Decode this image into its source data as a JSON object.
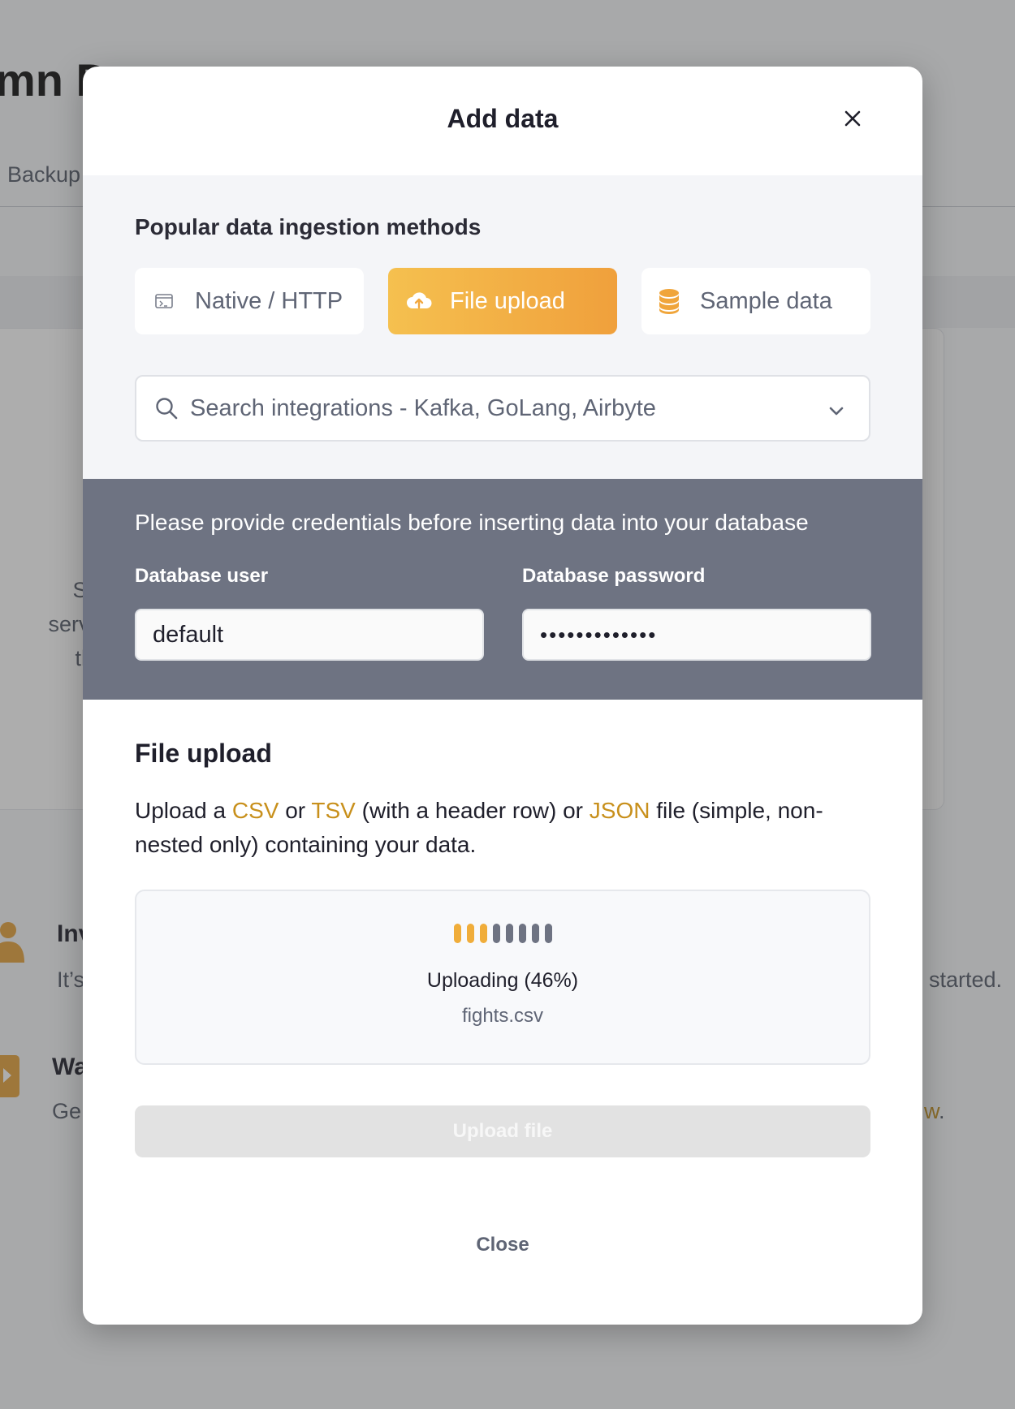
{
  "background": {
    "title_fragment": "mn D",
    "tab_fragment": "Backup",
    "card_text": [
      "Sta",
      "servic",
      "the"
    ],
    "item1": {
      "title_fragment": "Inv",
      "desc_fragment": "It’s",
      "right_fragment": "started."
    },
    "item2": {
      "title_fragment": "Wa",
      "desc_fragment": "Ge",
      "right_fragment": "w",
      "right_suffix": "."
    }
  },
  "modal": {
    "title": "Add data",
    "close_icon": "close-icon",
    "methods": {
      "label": "Popular data ingestion methods",
      "items": [
        {
          "label": "Native / HTTP",
          "icon": "terminal-icon",
          "selected": false
        },
        {
          "label": "File upload",
          "icon": "cloud-upload-icon",
          "selected": true
        },
        {
          "label": "Sample data",
          "icon": "database-icon",
          "selected": false
        }
      ]
    },
    "search": {
      "placeholder": "Search integrations - Kafka, GoLang, Airbyte"
    },
    "credentials": {
      "message": "Please provide credentials before inserting data into your database",
      "user_label": "Database user",
      "user_value": "default",
      "password_label": "Database password",
      "password_value": "•••••••••••••"
    },
    "file_upload": {
      "heading": "File upload",
      "desc_1": "Upload a ",
      "kw_csv": "CSV",
      "desc_2": " or ",
      "kw_tsv": "TSV",
      "desc_3": " (with a header row) or ",
      "kw_json": "JSON",
      "desc_4": " file (simple, non-nested only) containing your data.",
      "progress_percent": 46,
      "status": "Uploading (46%)",
      "filename": "fights.csv",
      "upload_button": "Upload file",
      "close_label": "Close"
    },
    "colors": {
      "accent": "#f0ad3a",
      "credentials_bg": "#6e7382",
      "keyword": "#c8901c"
    }
  }
}
